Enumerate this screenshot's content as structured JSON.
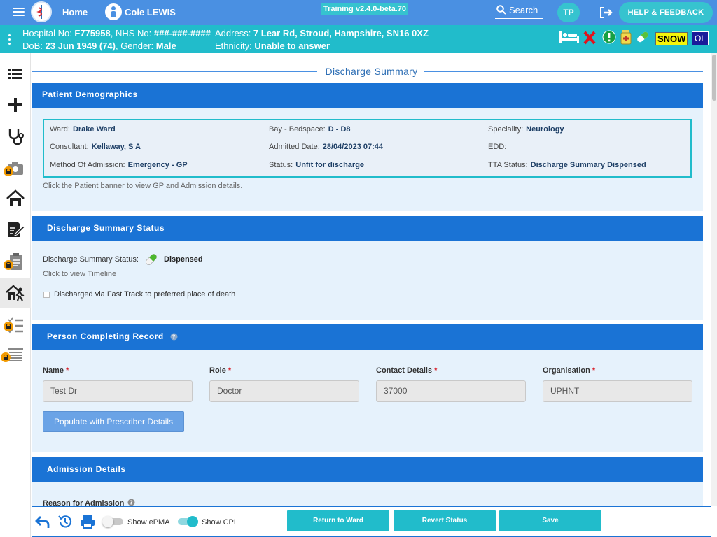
{
  "topbar": {
    "home": "Home",
    "patient_name": "Cole LEWIS",
    "version": "Training v2.4.0-beta.70",
    "search": "Search",
    "user_initials": "TP",
    "help": "HELP & FEEDBACK"
  },
  "banner": {
    "line1_prefix": "Hospital No: ",
    "hospital_no": "F775958",
    "nhs_prefix": ", NHS No: ",
    "nhs_no": "###-###-####",
    "dob_prefix": "DoB: ",
    "dob": "23 Jun 1949 (74)",
    "gender_prefix": ", Gender: ",
    "gender": "Male",
    "address_prefix": "Address: ",
    "address": "7 Lear Rd, Stroud, Hampshire, SN16 0XZ",
    "ethnicity_prefix": "Ethnicity: ",
    "ethnicity": "Unable to answer",
    "badges": {
      "snow": "SNOW",
      "ol": "OL"
    }
  },
  "page": {
    "title": "Discharge Summary"
  },
  "demographics": {
    "header": "Patient Demographics",
    "ward_label": "Ward:",
    "ward": "Drake Ward",
    "bay_label": "Bay - Bedspace:",
    "bay": "D - D8",
    "speciality_label": "Speciality:",
    "speciality": "Neurology",
    "consultant_label": "Consultant:",
    "consultant": "Kellaway, S A",
    "admitted_label": "Admitted Date:",
    "admitted": "28/04/2023 07:44",
    "edd_label": "EDD:",
    "edd": "",
    "method_label": "Method Of Admission:",
    "method": "Emergency - GP",
    "status_label": "Status:",
    "status": "Unfit for discharge",
    "tta_label": "TTA Status:",
    "tta": "Discharge Summary Dispensed",
    "hint": "Click the Patient banner to view GP and Admission details."
  },
  "ds_status": {
    "header": "Discharge Summary Status",
    "label": "Discharge Summary Status:",
    "value": "Dispensed",
    "timeline": "Click to view Timeline",
    "fasttrack": "Discharged via Fast Track to preferred place of death"
  },
  "person": {
    "header": "Person Completing Record",
    "name_label": "Name",
    "name_value": "Test Dr",
    "role_label": "Role",
    "role_value": "Doctor",
    "contact_label": "Contact Details",
    "contact_value": "37000",
    "org_label": "Organisation",
    "org_value": "UPHNT",
    "required_mark": "*",
    "populate_button": "Populate with Prescriber Details"
  },
  "admission": {
    "header": "Admission Details",
    "reason_label": "Reason for Admission"
  },
  "bottom": {
    "show_epma": "Show ePMA",
    "show_epma_on": false,
    "show_cpl": "Show CPL",
    "show_cpl_on": true,
    "return_btn": "Return to Ward",
    "revert_btn": "Revert Status",
    "save_btn": "Save"
  },
  "colors": {
    "topbar": "#4a90e2",
    "banner": "#21bccb",
    "panel_header": "#1a73d5",
    "panel_bg": "#e6f2fc",
    "action_button": "#21bccb"
  }
}
